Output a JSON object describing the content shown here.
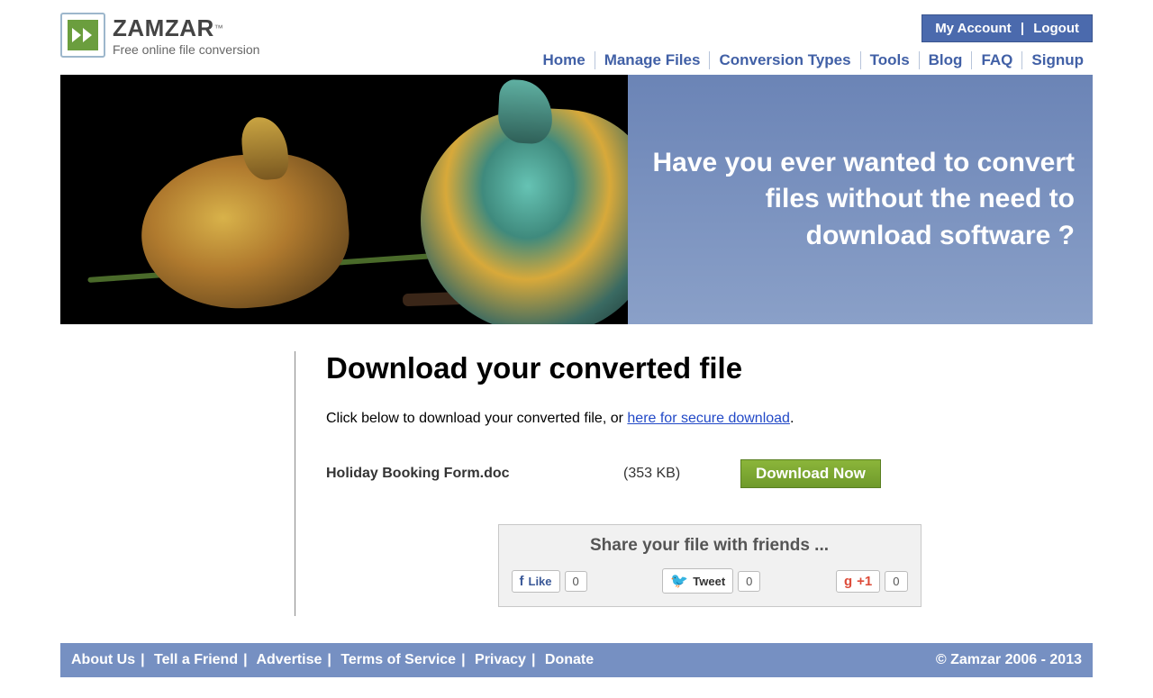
{
  "brand": {
    "name": "ZAMZAR",
    "tm": "™",
    "tagline": "Free online file conversion"
  },
  "account": {
    "my": "My Account",
    "logout": "Logout"
  },
  "nav": {
    "home": "Home",
    "manage": "Manage Files",
    "types": "Conversion Types",
    "tools": "Tools",
    "blog": "Blog",
    "faq": "FAQ",
    "signup": "Signup"
  },
  "hero": {
    "line": "Have you ever wanted to convert files without the need to download software ?"
  },
  "main": {
    "title": "Download your converted file",
    "instr_pre": "Click below to download your converted file, or ",
    "instr_link": "here for secure download",
    "instr_post": ".",
    "file_name": "Holiday Booking Form.doc",
    "file_size": "(353 KB)",
    "download_btn": "Download Now"
  },
  "share": {
    "title": "Share your file with friends ...",
    "like": "Like",
    "like_count": "0",
    "tweet": "Tweet",
    "tweet_count": "0",
    "gplus": "+1",
    "gplus_count": "0"
  },
  "footer": {
    "about": "About Us",
    "tell": "Tell a Friend",
    "adv": "Advertise",
    "tos": "Terms of Service",
    "priv": "Privacy",
    "donate": "Donate",
    "copyright": "© Zamzar 2006 - 2013"
  }
}
